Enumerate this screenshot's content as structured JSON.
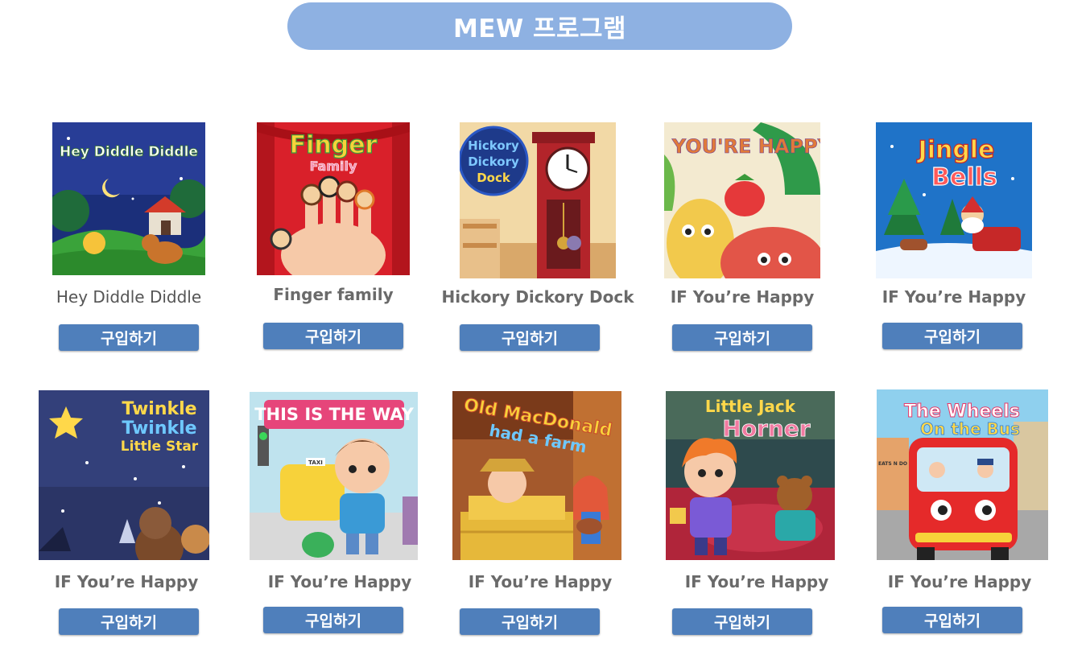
{
  "header": {
    "title": "MEW 프로그램"
  },
  "products": [
    {
      "title": "Hey Diddle Diddle",
      "thumb_text": [
        "Hey Diddle Diddle"
      ],
      "buy_label": "구입하기",
      "bg": "#1b2f7a"
    },
    {
      "title": "Finger family",
      "thumb_text": [
        "Finger",
        "Family"
      ],
      "buy_label": "구입하기",
      "bg": "#d9202a"
    },
    {
      "title": "Hickory Dickory Dock",
      "thumb_text": [
        "Hickory",
        "Dickory",
        "Dock"
      ],
      "buy_label": "구입하기",
      "bg": "#f2d9a6"
    },
    {
      "title": "IF You’re Happy",
      "thumb_text": [
        "IF YOU'RE HAPPY"
      ],
      "buy_label": "구입하기",
      "bg": "#f3ead0"
    },
    {
      "title": "IF You’re Happy",
      "thumb_text": [
        "Jingle",
        "Bells"
      ],
      "buy_label": "구입하기",
      "bg": "#1f73c8"
    },
    {
      "title": "IF You’re Happy",
      "thumb_text": [
        "Twinkle",
        "Twinkle",
        "Little Star"
      ],
      "buy_label": "구입하기",
      "bg": "#2b3566"
    },
    {
      "title": "IF You’re Happy",
      "thumb_text": [
        "THIS IS THE WAY",
        "TAXI"
      ],
      "buy_label": "구입하기",
      "bg": "#bfe3ee"
    },
    {
      "title": "IF You’re Happy",
      "thumb_text": [
        "Old MacDonald",
        "had a farm"
      ],
      "buy_label": "구입하기",
      "bg": "#a4592c"
    },
    {
      "title": "IF You’re Happy",
      "thumb_text": [
        "Little Jack",
        "Horner"
      ],
      "buy_label": "구입하기",
      "bg": "#2e4a4d"
    },
    {
      "title": "IF You’re Happy",
      "thumb_text": [
        "The Wheels",
        "On the Bus",
        "EATS N DO"
      ],
      "buy_label": "구입하기",
      "bg": "#8fd0ee"
    }
  ]
}
